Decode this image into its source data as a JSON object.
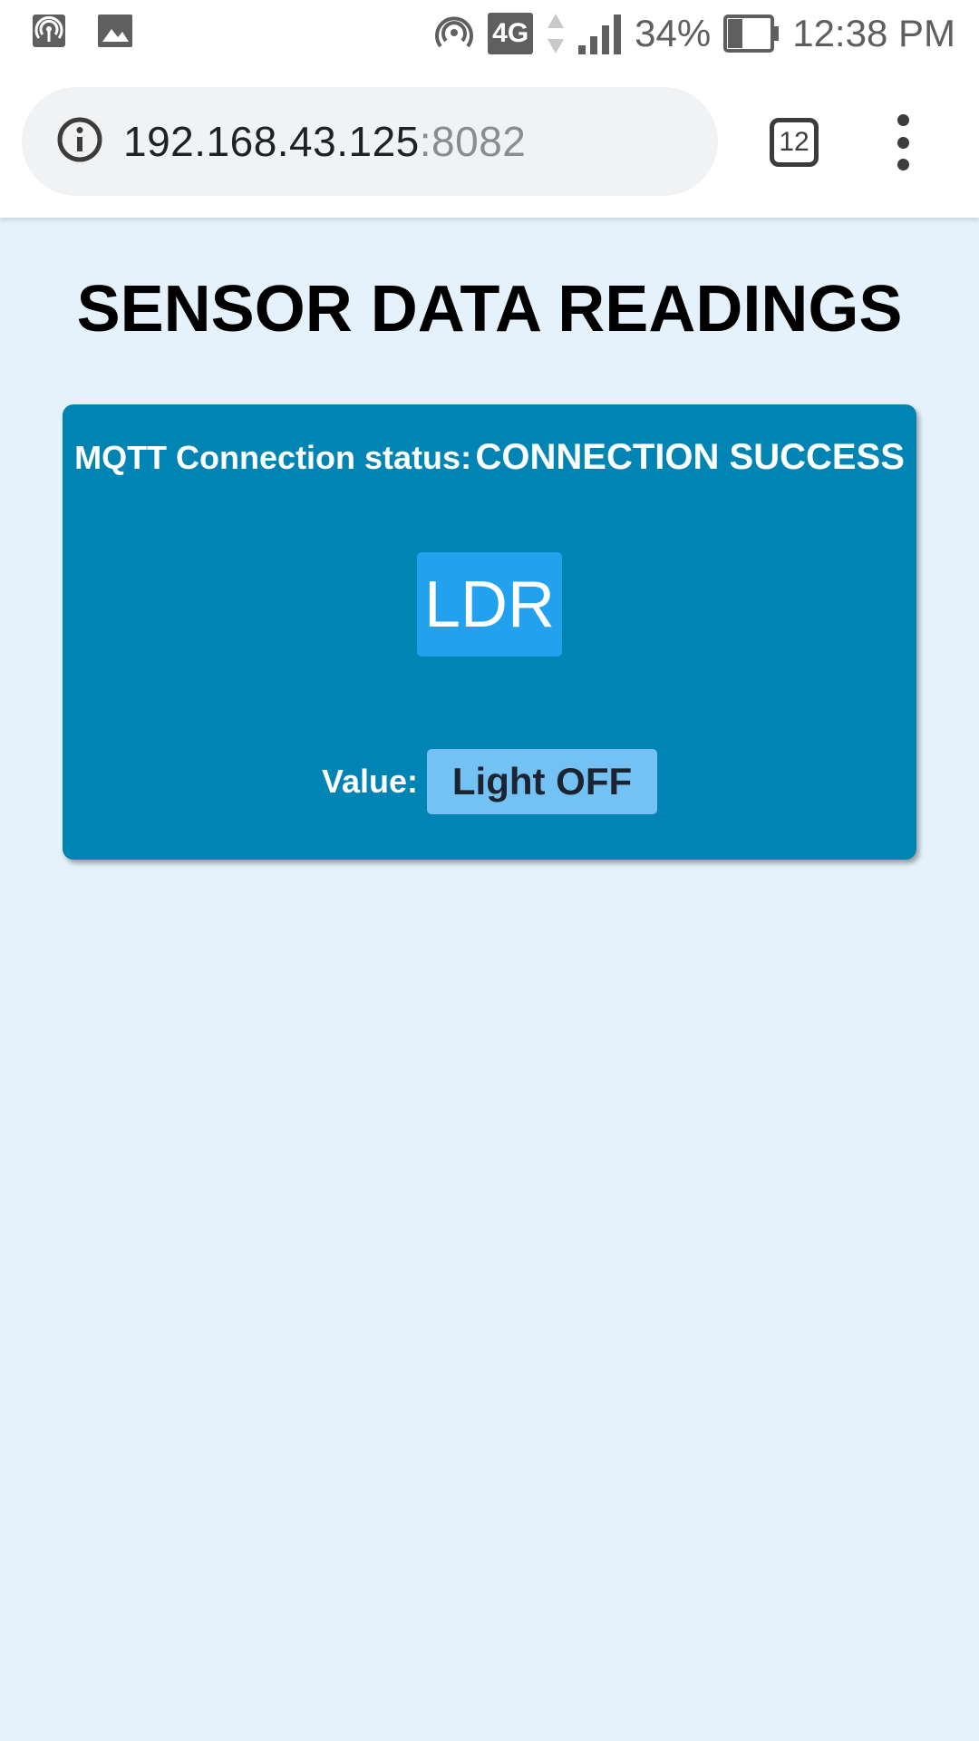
{
  "status_bar": {
    "icons_left": [
      "hotspot-icon",
      "image-icon"
    ],
    "hotspot_icon": "hotspot-icon",
    "network_type": "4G",
    "battery_percent": "34%",
    "time": "12:38 PM"
  },
  "browser": {
    "url_host": "192.168.43.125",
    "url_port": ":8082",
    "tab_count": "12"
  },
  "page": {
    "title": "SENSOR DATA READINGS",
    "card": {
      "status_label": "MQTT Connection status:",
      "status_value": "CONNECTION SUCCESS",
      "sensor_name": "LDR",
      "value_label": "Value:",
      "value": "Light OFF"
    }
  },
  "colors": {
    "page_background": "#e6f2fb",
    "card_background": "#0084b4",
    "sensor_box": "#22a1ef",
    "value_box": "#74c2f4"
  }
}
